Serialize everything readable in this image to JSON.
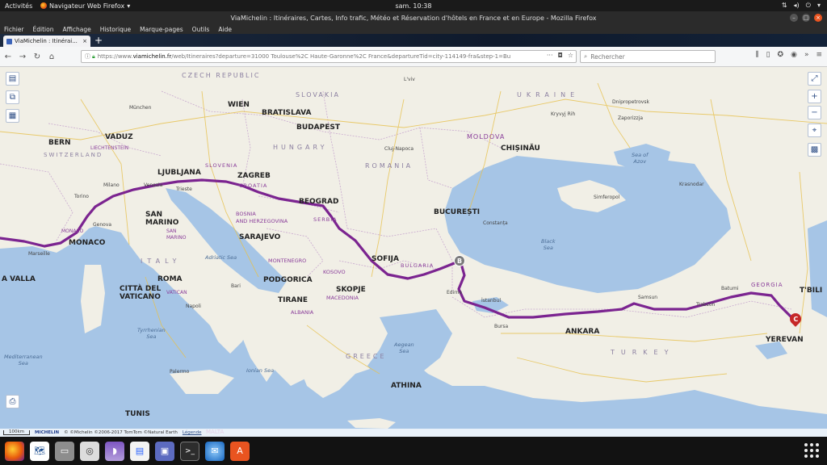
{
  "system_bar": {
    "activities": "Activités",
    "app_name": "Navigateur Web Firefox",
    "clock": "sam. 10:38"
  },
  "window": {
    "title": "ViaMichelin : Itinéraires, Cartes, Info trafic, Météo et Réservation d'hôtels en France et en Europe - Mozilla Firefox"
  },
  "menu": [
    "Fichier",
    "Édition",
    "Affichage",
    "Historique",
    "Marque-pages",
    "Outils",
    "Aide"
  ],
  "tab": {
    "title": "ViaMichelin : Itinérai..."
  },
  "url": {
    "scheme": "https://www.",
    "host": "viamichelin.fr",
    "path": "/web/Itineraires?departure=31000 Toulouse%2C Haute-Garonne%2C France&departureTid=city-114149-fra&step-1=Bu"
  },
  "search": {
    "placeholder": "Rechercher"
  },
  "map": {
    "labels": {
      "wien": "WIEN",
      "bratislava": "BRATISLAVA",
      "budapest": "BUDAPEST",
      "bern": "BERN",
      "vaduz": "VADUZ",
      "ljubljana": "LJUBLJANA",
      "zagreb": "ZAGREB",
      "beograd": "BEOGRAD",
      "bucuresti": "BUCUREȘTI",
      "chisinau": "CHIȘINĂU",
      "sarajevo": "SARAJEVO",
      "podgorica": "PODGORICA",
      "tirane": "TIRANE",
      "skopje": "SKOPJE",
      "sofija": "SOFIJA",
      "roma": "ROMA",
      "vaticano": "CITTÀ DEL\nVATICANO",
      "san_marino": "SAN\nMARINO",
      "monaco": "MONACO",
      "athina": "ATHINA",
      "ankara": "ANKARA",
      "yerevan": "YEREVAN",
      "tbilisi": "T'BILI",
      "tunis": "TUNIS",
      "malta": "MALTA",
      "la_valla": "A VALLA",
      "munchen": "München",
      "milano": "Milano",
      "torino": "Torino",
      "genova": "Genova",
      "marseille": "Marseille",
      "venezia": "Venezia",
      "trieste": "Trieste",
      "istanbul": "İstanbul",
      "bursa": "Bursa",
      "edirne": "Edirne",
      "samsun": "Samsun",
      "trabzon": "Trabzon",
      "batumi": "Batumi",
      "napoli": "Napoli",
      "bari": "Bari",
      "palermo": "Palermo",
      "dnipropetrovsk": "Dnipropetrovsk",
      "zaporizzja": "Zaporizzja",
      "cluj": "Cluj-Napoca",
      "constanta": "Constanța",
      "kryvyi_rih": "Kryvyj Rih",
      "simferopol": "Simferopol",
      "krasnodar": "Krasnodar",
      "lviv": "L'viv"
    },
    "countries": {
      "ukraine": "UKRAINE",
      "moldova": "MOLDOVA",
      "romania": "ROMANIA",
      "hungary": "HUNGARY",
      "slovakia": "SLOVAKIA",
      "czech": "CZECH REPUBLIC",
      "switzerland": "SWITZERLAND",
      "liechtenstein": "LIECHTENSTEIN",
      "slovenia": "SLOVENIA",
      "croatia": "CROATIA",
      "bosnia": "BOSNIA\nAND HERZEGOVINA",
      "serbia": "SERBIA",
      "montenegro": "MONTENEGRO",
      "kosovo": "KOSOVO",
      "albania": "ALBANIA",
      "macedonia": "MACEDONIA",
      "bulgaria": "BULGARIA",
      "greece": "GREECE",
      "turkey": "TURKEY",
      "georgia": "GEORGIA",
      "italy": "ITALY",
      "san_marino_c": "SAN\nMARINO",
      "monaco_c": "MONACO",
      "vatican_c": "VATICAN"
    },
    "seas": {
      "black_sea": "Black\nSea",
      "adriatic": "Adriatic Sea",
      "tyrrhenian": "Tyrrhenian\nSea",
      "ionian": "Ionian Sea",
      "aegean": "Aegean\nSea",
      "mediterranean": "Mediterranean\nSea",
      "sea_of_azov": "Sea of\nAzov"
    },
    "markers": {
      "b": "B",
      "c": "C"
    },
    "attribution": {
      "scale": "100km",
      "brand": "MICHELIN",
      "copyright": "© ©Michelin ©2006-2017 TomTom ©Natural Earth",
      "legend": "Légende"
    }
  },
  "colors": {
    "route": "#7b2490",
    "sea": "#a6c5e6",
    "land": "#f1efe6",
    "marker_b": "#7a7a7a",
    "marker_c": "#c62828",
    "accent_ubuntu": "#e95420"
  },
  "dock": {
    "apps": [
      "firefox-icon",
      "world-map-icon",
      "files-icon",
      "disk-icon",
      "eagle-icon",
      "writer-icon",
      "image-viewer-icon",
      "terminal-icon",
      "thunderbird-icon",
      "software-center-icon"
    ]
  }
}
